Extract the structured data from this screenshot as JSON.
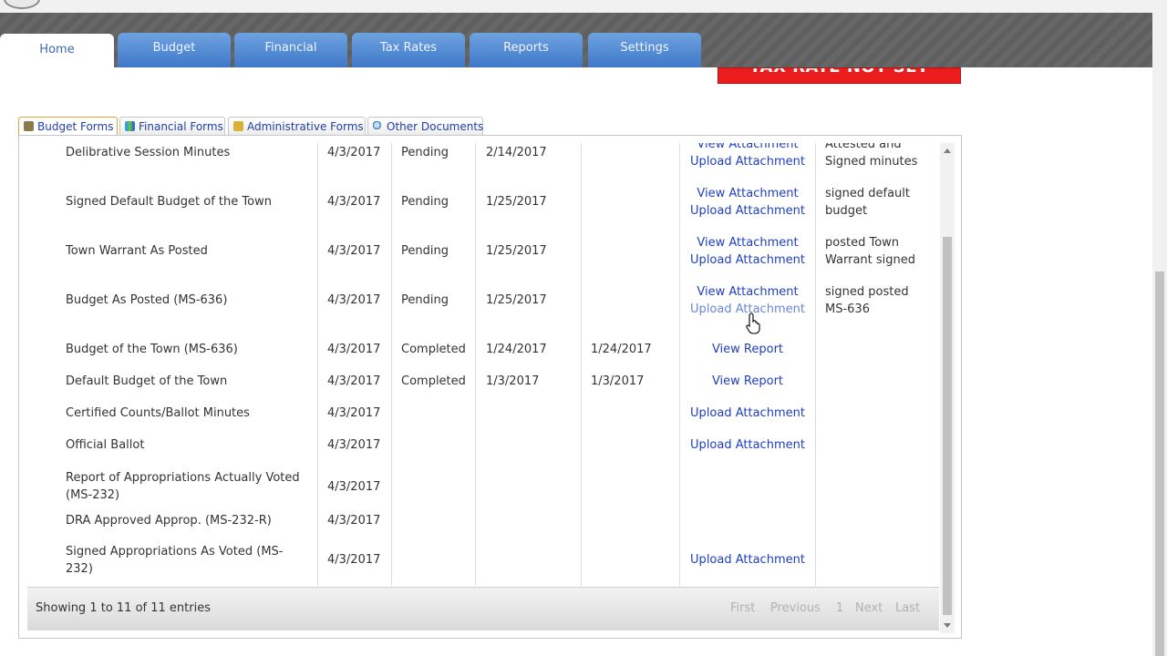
{
  "nav": {
    "tabs": [
      {
        "label": "Home"
      },
      {
        "label": "Budget"
      },
      {
        "label": "Financial"
      },
      {
        "label": "Tax Rates"
      },
      {
        "label": "Reports"
      },
      {
        "label": "Settings"
      }
    ]
  },
  "banner": {
    "text": "TAX RATE NOT SET"
  },
  "subtabs": [
    {
      "label": "Budget Forms",
      "icon": "printer-icon"
    },
    {
      "label": "Financial Forms",
      "icon": "chart-icon"
    },
    {
      "label": "Administrative Forms",
      "icon": "folder-icon"
    },
    {
      "label": "Other Documents",
      "icon": "magnifier-icon"
    }
  ],
  "table": {
    "rows": [
      {
        "name": "Delibrative Session Minutes",
        "date": "4/3/2017",
        "status": "Pending",
        "due": "2/14/2017",
        "completed": "",
        "link1": "View Attachment",
        "link2": "Upload Attachment",
        "notes": "Attested and Signed minutes"
      },
      {
        "name": "Signed Default Budget of the Town",
        "date": "4/3/2017",
        "status": "Pending",
        "due": "1/25/2017",
        "completed": "",
        "link1": "View Attachment",
        "link2": "Upload Attachment",
        "notes": "signed default budget"
      },
      {
        "name": "Town Warrant As Posted",
        "date": "4/3/2017",
        "status": "Pending",
        "due": "1/25/2017",
        "completed": "",
        "link1": "View Attachment",
        "link2": "Upload Attachment",
        "notes": "posted Town Warrant signed"
      },
      {
        "name": "Budget As Posted (MS-636)",
        "date": "4/3/2017",
        "status": "Pending",
        "due": "1/25/2017",
        "completed": "",
        "link1": "View Attachment",
        "link2": "Upload Attachment",
        "notes": "signed posted MS-636"
      },
      {
        "name": "Budget of the Town (MS-636)",
        "date": "4/3/2017",
        "status": "Completed",
        "due": "1/24/2017",
        "completed": "1/24/2017",
        "link1": "View Report",
        "link2": "",
        "notes": ""
      },
      {
        "name": "Default Budget of the Town",
        "date": "4/3/2017",
        "status": "Completed",
        "due": "1/3/2017",
        "completed": "1/3/2017",
        "link1": "View Report",
        "link2": "",
        "notes": ""
      },
      {
        "name": "Certified Counts/Ballot Minutes",
        "date": "4/3/2017",
        "status": "",
        "due": "",
        "completed": "",
        "link1": "Upload Attachment",
        "link2": "",
        "notes": ""
      },
      {
        "name": "Official Ballot",
        "date": "4/3/2017",
        "status": "",
        "due": "",
        "completed": "",
        "link1": "Upload Attachment",
        "link2": "",
        "notes": ""
      },
      {
        "name": "Report of Appropriations Actually Voted (MS-232)",
        "date": "4/3/2017",
        "status": "",
        "due": "",
        "completed": "",
        "link1": "",
        "link2": "",
        "notes": ""
      },
      {
        "name": "DRA Approved Approp. (MS-232-R)",
        "date": "4/3/2017",
        "status": "",
        "due": "",
        "completed": "",
        "link1": "",
        "link2": "",
        "notes": ""
      },
      {
        "name": "Signed Appropriations As Voted (MS-232)",
        "date": "4/3/2017",
        "status": "",
        "due": "",
        "completed": "",
        "link1": "Upload Attachment",
        "link2": "",
        "notes": ""
      }
    ]
  },
  "footer": {
    "info": "Showing 1 to 11 of 11 entries",
    "first": "First",
    "previous": "Previous",
    "page": "1",
    "next": "Next",
    "last": "Last"
  }
}
